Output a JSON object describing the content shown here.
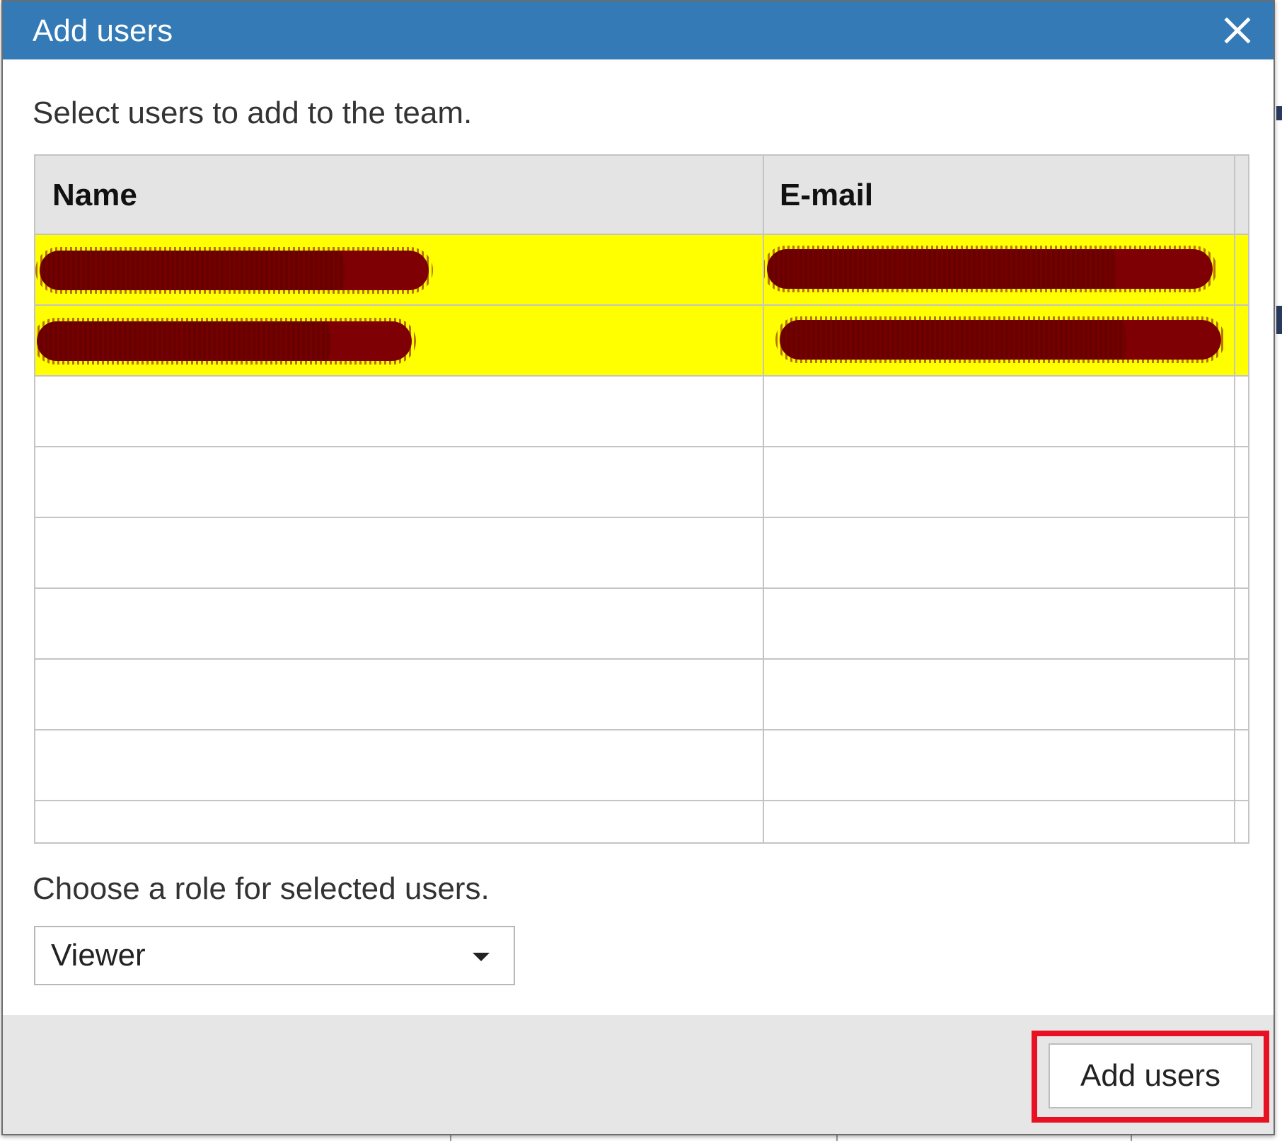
{
  "dialog": {
    "title": "Add users",
    "close_icon": "close-icon",
    "instruction": "Select users to add to the team."
  },
  "table": {
    "columns": [
      "Name",
      "E-mail"
    ],
    "rows": [
      {
        "name": "",
        "email": "",
        "selected": true,
        "redacted": true
      },
      {
        "name": "",
        "email": "",
        "selected": true,
        "redacted": true
      },
      {
        "name": "",
        "email": "",
        "selected": false
      },
      {
        "name": "",
        "email": "",
        "selected": false
      },
      {
        "name": "",
        "email": "",
        "selected": false
      },
      {
        "name": "",
        "email": "",
        "selected": false
      },
      {
        "name": "",
        "email": "",
        "selected": false
      },
      {
        "name": "",
        "email": "",
        "selected": false
      },
      {
        "name": "",
        "email": "",
        "selected": false
      }
    ],
    "selected_row_color": "#ffff00"
  },
  "role": {
    "label": "Choose a role for selected users.",
    "value": "Viewer"
  },
  "footer": {
    "add_label": "Add users"
  },
  "colors": {
    "titlebar": "#337ab7",
    "highlight": "#e81123",
    "redaction": "#7e0010"
  }
}
